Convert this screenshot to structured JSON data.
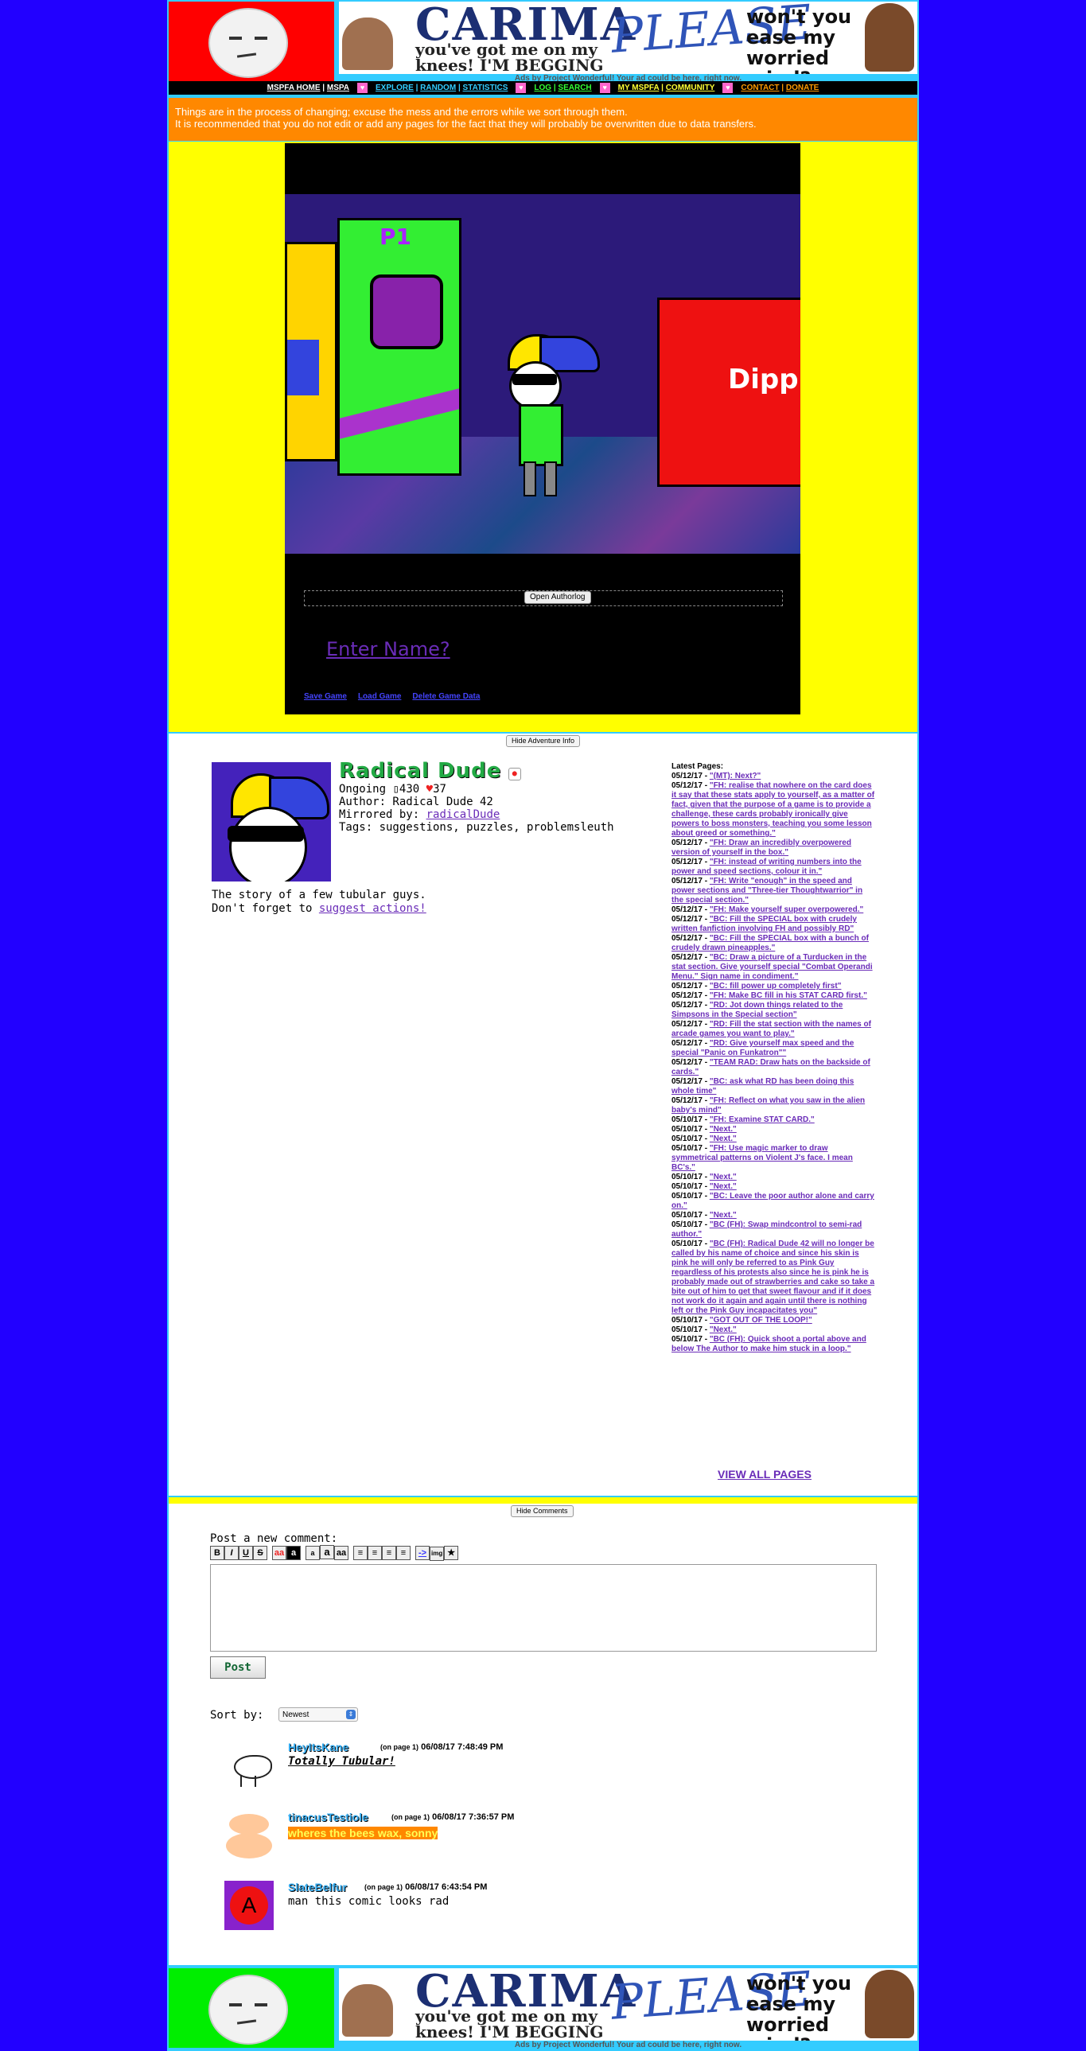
{
  "colors": {
    "page_bg": "#2200ff",
    "frame": "#33ccff",
    "banner_logo_top": "#ff0000",
    "banner_logo_bottom": "#00ee00",
    "notice_bg": "#ff8800",
    "comic_bg": "#ffff00",
    "link": "#6a2cb8"
  },
  "banner": {
    "ad_line1": "CARIMA",
    "ad_line2": "you've got me on my knees! I'M BEGGING DARLING",
    "ad_line3": "PLEASE",
    "ad_line4": "won't you ease my worried mind?",
    "credit": "Ads by Project Wonderful! Your ad could be here, right now."
  },
  "nav": {
    "items": [
      "MSPFA HOME",
      "MSPA",
      "EXPLORE",
      "RANDOM",
      "STATISTICS",
      "LOG",
      "SEARCH",
      "MY MSPFA",
      "COMMUNITY",
      "CONTACT",
      "DONATE"
    ],
    "heart": "♥"
  },
  "notice": {
    "line1": "Things are in the process of changing; excuse the mess and the errors while we sort through them.",
    "line2": "It is recommended that you do not edit or add any pages for the fact that they will probably be overwritten due to data transfers."
  },
  "comic": {
    "cabinet_label": "P1",
    "sign_text": "Dippin",
    "open_authorlog": "Open Authorlog",
    "enter_name": "Enter Name?",
    "save_game": "Save Game",
    "load_game": "Load Game",
    "delete_game": "Delete Game Data"
  },
  "info": {
    "hide_info": "Hide Adventure Info",
    "title": "Radical Dude",
    "status": "Ongoing",
    "pages": "430",
    "favs": "37",
    "author": "Author: Radical Dude 42",
    "mirrored_label": "Mirrored by:",
    "mirrored": "radicalDude",
    "tags": "Tags: suggestions, puzzles, problemsleuth",
    "blurb1": "The story of a few tubular guys.",
    "blurb2": "Don't forget to",
    "blurb_link": "suggest actions!",
    "latest_heading": "Latest Pages:",
    "view_all": "VIEW ALL PAGES"
  },
  "latest_pages": [
    {
      "date": "05/12/17",
      "title": "\"(MT): Next?\""
    },
    {
      "date": "05/12/17",
      "title": "\"FH: realise that nowhere on the card does it say that these stats apply to yourself, as a matter of fact, given that the purpose of a game is to provide a challenge, these cards probably ironically give powers to boss monsters, teaching you some lesson about greed or something.\""
    },
    {
      "date": "05/12/17",
      "title": "\"FH: Draw an incredibly overpowered version of yourself in the box.\""
    },
    {
      "date": "05/12/17",
      "title": "\"FH: instead of writing numbers into the power and speed sections, colour it in.\""
    },
    {
      "date": "05/12/17",
      "title": "\"FH: Write \"enough\" in the speed and power sections and \"Three-tier Thoughtwarrior\" in the special section.\""
    },
    {
      "date": "05/12/17",
      "title": "\"FH: Make yourself super overpowered.\""
    },
    {
      "date": "05/12/17",
      "title": "\"BC: Fill the SPECIAL box with crudely written fanfiction involving FH and possibly RD\""
    },
    {
      "date": "05/12/17",
      "title": "\"BC: Fill the SPECIAL box with a bunch of crudely drawn pineapples.\""
    },
    {
      "date": "05/12/17",
      "title": "\"BC: Draw a picture of a Turducken in the stat section. Give yourself special \"Combat Operandi Menu.\" Sign name in condiment.\""
    },
    {
      "date": "05/12/17",
      "title": "\"BC: fill power up completely first\""
    },
    {
      "date": "05/12/17",
      "title": "\"FH: Make BC fill in his STAT CARD first.\""
    },
    {
      "date": "05/12/17",
      "title": "\"RD: Jot down things related to the Simpsons in the Special section\""
    },
    {
      "date": "05/12/17",
      "title": "\"RD: Fill the stat section with the names of arcade games you want to play.\""
    },
    {
      "date": "05/12/17",
      "title": "\"RD: Give yourself max speed and the special \"Panic on Funkatron\"\""
    },
    {
      "date": "05/12/17",
      "title": "\"TEAM RAD: Draw hats on the backside of cards.\""
    },
    {
      "date": "05/12/17",
      "title": "\"BC: ask what RD has been doing this whole time\""
    },
    {
      "date": "05/12/17",
      "title": "\"FH: Reflect on what you saw in the alien baby's mind\""
    },
    {
      "date": "05/10/17",
      "title": "\"FH: Examine STAT CARD.\""
    },
    {
      "date": "05/10/17",
      "title": "\"Next.\""
    },
    {
      "date": "05/10/17",
      "title": "\"Next.\""
    },
    {
      "date": "05/10/17",
      "title": "\"FH: Use magic marker to draw symmetrical patterns on Violent J's face. I mean BC's.\""
    },
    {
      "date": "05/10/17",
      "title": "\"Next.\""
    },
    {
      "date": "05/10/17",
      "title": "\"Next.\""
    },
    {
      "date": "05/10/17",
      "title": "\"BC: Leave the poor author alone and carry on.\""
    },
    {
      "date": "05/10/17",
      "title": "\"Next.\""
    },
    {
      "date": "05/10/17",
      "title": "\"BC (FH): Swap mindcontrol to semi-rad author.\""
    },
    {
      "date": "05/10/17",
      "title": "\"BC (FH): Radical Dude 42 will no longer be called by his name of choice and since his skin is pink he will only be referred to as Pink Guy regardless of his protests also since he is pink he is probably made out of strawberries and cake so take a bite out of him to get that sweet flavour and if it does not work do it again and again until there is nothing left or the Pink Guy incapacitates you\""
    },
    {
      "date": "05/10/17",
      "title": "\"GOT OUT OF THE LOOP!\""
    },
    {
      "date": "05/10/17",
      "title": "\"Next.\""
    },
    {
      "date": "05/10/17",
      "title": "\"BC (FH): Quick shoot a portal above and below The Author to make him stuck in a loop.\""
    }
  ],
  "comments_section": {
    "hide_comments": "Hide Comments",
    "post_label": "Post a new comment:",
    "toolbar": [
      "B",
      "I",
      "U",
      "S",
      "aa",
      "a",
      "a",
      "a",
      "aa",
      "≡",
      "≡",
      "≡",
      "≡",
      "->",
      "img",
      "★"
    ],
    "post_button": "Post",
    "sort_label": "Sort by:",
    "sort_value": "Newest",
    "items": [
      {
        "user": "HeyItsKane",
        "page": "(on page 1)",
        "time": "06/08/17 7:48:49 PM",
        "text": "Totally Tubular!"
      },
      {
        "user": "tinacusTestiole",
        "page": "(on page 1)",
        "time": "06/08/17 7:36:57 PM",
        "text": "wheres the bees wax, sonny"
      },
      {
        "user": "SlateBelfur",
        "page": "(on page 1)",
        "time": "06/08/17 6:43:54 PM",
        "text": "man this comic looks rad"
      }
    ]
  }
}
